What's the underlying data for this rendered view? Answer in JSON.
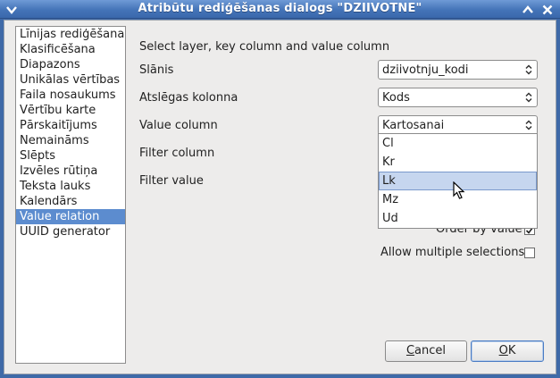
{
  "window": {
    "title": "Atribūtu rediģēšanas dialogs \"DZIIVOTNE\""
  },
  "widget_types": [
    "Līnijas rediģēšana",
    "Klasificēšana",
    "Diapazons",
    "Unikālas vērtības",
    "Faila nosaukums",
    "Vērtību karte",
    "Pārskaitījums",
    "Nemaināms",
    "Slēpts",
    "Izvēles rūtiņa",
    "Teksta lauks",
    "Kalendārs",
    "Value relation",
    "UUID generator"
  ],
  "selected_widget": "Value relation",
  "form": {
    "heading": "Select layer, key column and value column",
    "layer_label": "Slānis",
    "layer_value": "dziivotnju_kodi",
    "key_label": "Atslēgas kolonna",
    "key_value": "Kods",
    "value_label": "Value column",
    "value_value": "Kartosanai",
    "filter_column_label": "Filter column",
    "filter_value_label": "Filter value",
    "order_by_value_label": "Order by value",
    "order_by_value_checked": true,
    "allow_multiple_label": "Allow multiple selections",
    "allow_multiple_checked": false
  },
  "dropdown": {
    "options": [
      "Cl",
      "Kr",
      "Lk",
      "Mz",
      "Ud"
    ],
    "hovered": "Lk"
  },
  "buttons": {
    "cancel_prefix": "",
    "cancel_mnemonic": "C",
    "cancel_rest": "ancel",
    "ok_mnemonic": "O",
    "ok_rest": "K"
  },
  "colors": {
    "title_bar": "#4474b8",
    "selection": "#5c8ccf",
    "hover": "#c6d6ef"
  }
}
